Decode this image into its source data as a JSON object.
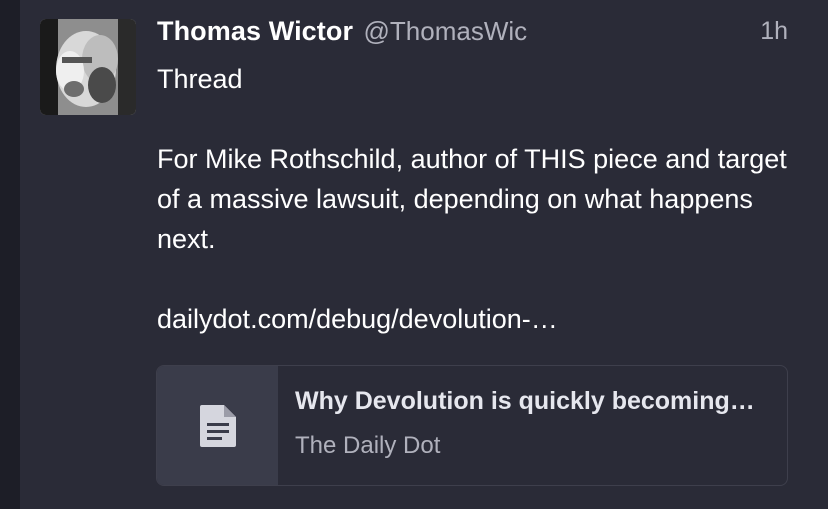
{
  "tweet": {
    "author_name": "Thomas Wictor",
    "author_handle": "@ThomasWic",
    "timestamp": "1h",
    "lines": {
      "line1": "Thread",
      "line2": "For Mike Rothschild, author of THIS piece and target of a massive lawsuit, depending on what happens next.",
      "link": "dailydot.com/debug/devolution-…"
    },
    "avatar_icon": "profile-photo",
    "link_card": {
      "icon": "document-icon",
      "title": "Why Devolution is quickly becoming…",
      "source": "The Daily Dot"
    }
  },
  "colors": {
    "background": "#2a2b37",
    "page": "#1d1e27",
    "text_primary": "#ffffff",
    "text_secondary": "#b0b1bc",
    "card_thumb": "#3a3c4a",
    "card_border": "#3e3f4c"
  }
}
